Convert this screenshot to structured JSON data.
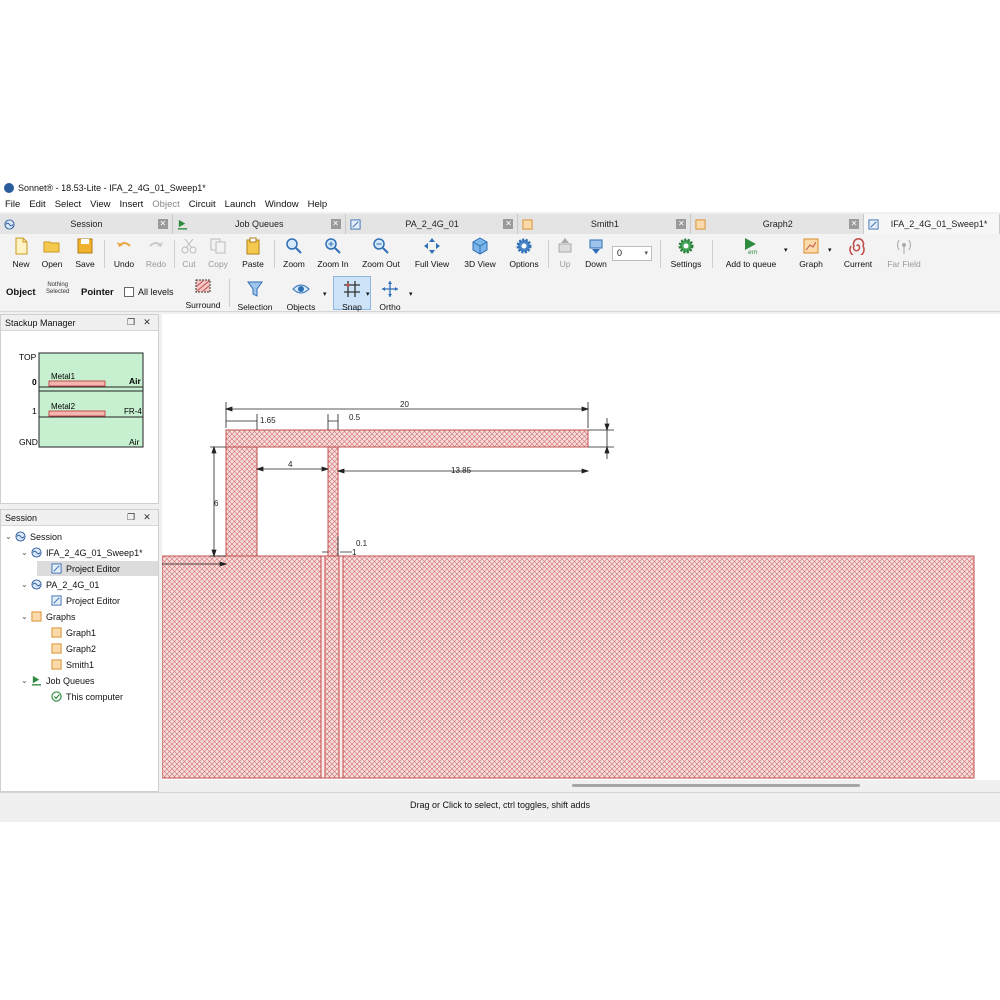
{
  "window": {
    "title": "Sonnet® - 18.53-Lite - IFA_2_4G_01_Sweep1*"
  },
  "menu": [
    "File",
    "Edit",
    "Select",
    "View",
    "Insert",
    "Object",
    "Circuit",
    "Launch",
    "Window",
    "Help"
  ],
  "tabs": [
    {
      "label": "Session"
    },
    {
      "label": "Job Queues"
    },
    {
      "label": "PA_2_4G_01"
    },
    {
      "label": "Smith1"
    },
    {
      "label": "Graph2"
    },
    {
      "label": "IFA_2_4G_01_Sweep1*"
    }
  ],
  "toolbar": {
    "new": "New",
    "open": "Open",
    "save": "Save",
    "undo": "Undo",
    "redo": "Redo",
    "cut": "Cut",
    "copy": "Copy",
    "paste": "Paste",
    "zoom": "Zoom",
    "zoom_in": "Zoom In",
    "zoom_out": "Zoom Out",
    "full_view": "Full View",
    "view3d": "3D View",
    "options": "Options",
    "up": "Up",
    "down": "Down",
    "level": "0",
    "settings": "Settings",
    "add_to_queue": "Add to queue",
    "graph": "Graph",
    "current": "Current",
    "far_field": "Far Field"
  },
  "toolbar2": {
    "object": "Object",
    "nothing_selected_1": "Nothing",
    "nothing_selected_2": "Selected",
    "pointer": "Pointer",
    "all_levels": "All levels",
    "surround": "Surround",
    "selection": "Selection",
    "objects": "Objects",
    "snap": "Snap",
    "ortho": "Ortho"
  },
  "stackup": {
    "title": "Stackup Manager",
    "top": "TOP",
    "gnd": "GND",
    "level0": "0",
    "level1": "1",
    "metal1": "Metal1",
    "metal2": "Metal2",
    "air_top": "Air",
    "fr4": "FR-4",
    "air_bottom": "Air"
  },
  "session": {
    "title": "Session",
    "items": [
      {
        "label": "Session"
      },
      {
        "label": "IFA_2_4G_01_Sweep1*"
      },
      {
        "label": "Project Editor"
      },
      {
        "label": "PA_2_4G_01"
      },
      {
        "label": "Project Editor"
      },
      {
        "label": "Graphs"
      },
      {
        "label": "Graph1"
      },
      {
        "label": "Graph2"
      },
      {
        "label": "Smith1"
      },
      {
        "label": "Job Queues"
      },
      {
        "label": "This computer"
      }
    ]
  },
  "dimensions": {
    "d20": "20",
    "d165": "1.65",
    "d05": "0.5",
    "d4": "4",
    "d1385": "13.85",
    "d6": "6",
    "d01": "0.1",
    "d1": "1"
  },
  "status": "Drag or Click to select, ctrl toggles, shift adds",
  "colors": {
    "metal_fill": "#f7dede",
    "metal_stroke": "#c0504d",
    "stackup_green": "#c6f0d0"
  }
}
